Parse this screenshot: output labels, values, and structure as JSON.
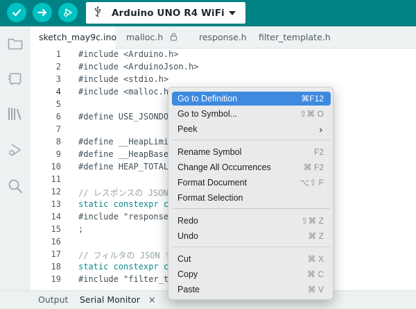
{
  "toolbar": {
    "verify_icon": "checkmark-icon",
    "upload_icon": "arrow-right-icon",
    "debug_icon": "debugger-icon",
    "board_name": "Arduino UNO R4 WiFi",
    "usb_icon": "usb-icon"
  },
  "sidebar": {
    "items": [
      {
        "icon": "folder-icon"
      },
      {
        "icon": "board-manager-icon"
      },
      {
        "icon": "library-icon"
      },
      {
        "icon": "debug-icon"
      },
      {
        "icon": "search-icon"
      }
    ]
  },
  "tabs": [
    {
      "label": "sketch_may9c.ino",
      "active": true
    },
    {
      "label": "malloc.h",
      "locked": true
    },
    {
      "label": "response.h"
    },
    {
      "label": "filter_template.h"
    }
  ],
  "editor": {
    "current_line": 4,
    "lines": [
      {
        "n": "1",
        "text": "#include <Arduino.h>"
      },
      {
        "n": "2",
        "text": "#include <ArduinoJson.h>"
      },
      {
        "n": "3",
        "text": "#include <stdio.h>"
      },
      {
        "n": "4",
        "text": "#include <malloc.h"
      },
      {
        "n": "5",
        "text": ""
      },
      {
        "n": "6",
        "text": "#define USE_JSONDO"
      },
      {
        "n": "7",
        "text": ""
      },
      {
        "n": "8",
        "text": "#define __HeapLimi"
      },
      {
        "n": "9",
        "text": "#define __HeapBase"
      },
      {
        "n": "10",
        "text": "#define HEAP_TOTAL"
      },
      {
        "n": "11",
        "text": ""
      },
      {
        "n": "12",
        "text": "// レスポンスの JSON"
      },
      {
        "n": "13",
        "text": "static constexpr c"
      },
      {
        "n": "14",
        "text": "#include \"response"
      },
      {
        "n": "15",
        "text": ";"
      },
      {
        "n": "16",
        "text": ""
      },
      {
        "n": "17",
        "text": "// フィルタの JSON テ"
      },
      {
        "n": "18",
        "text": "static constexpr c"
      },
      {
        "n": "19",
        "text": "#include \"filter_t"
      }
    ]
  },
  "bottom_panel": {
    "tabs": [
      {
        "label": "Output"
      },
      {
        "label": "Serial Monitor",
        "active": true,
        "close": "×"
      }
    ]
  },
  "context_menu": {
    "items": [
      {
        "label": "Go to Definition",
        "shortcut": "⌘F12",
        "highlighted": true
      },
      {
        "label": "Go to Symbol...",
        "shortcut": "⇧⌘ O"
      },
      {
        "label": "Peek",
        "submenu": "›"
      },
      {
        "label": "Rename Symbol",
        "shortcut": "F2"
      },
      {
        "label": "Change All Occurrences",
        "shortcut": "⌘ F2"
      },
      {
        "label": "Format Document",
        "shortcut": "⌥⇧ F"
      },
      {
        "label": "Format Selection",
        "shortcut": ""
      },
      {
        "label": "Redo",
        "shortcut": "⇧⌘ Z"
      },
      {
        "label": "Undo",
        "shortcut": "⌘ Z"
      },
      {
        "label": "Cut",
        "shortcut": "⌘ X"
      },
      {
        "label": "Copy",
        "shortcut": "⌘ C"
      },
      {
        "label": "Paste",
        "shortcut": "⌘ V"
      }
    ]
  },
  "colors": {
    "toolbar": "#008184",
    "toolbar_button": "#00c2c2",
    "menu_highlight": "#3d8ae0"
  }
}
